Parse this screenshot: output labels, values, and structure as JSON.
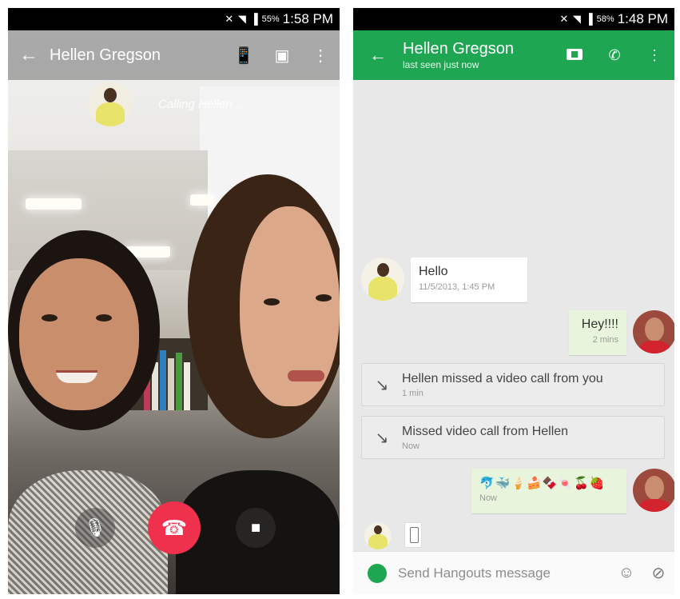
{
  "left_screen": {
    "status_time": "1:58 PM",
    "status_battery": "55%",
    "contact_name": "Hellen Gregson",
    "calling_text": "Calling Hellen...",
    "icons": {
      "back": "back-arrow-icon",
      "phone_signal": "cell-phone-icon",
      "contact_card": "contact-card-icon",
      "more": "more-vert-icon",
      "mic": "microphone-icon",
      "hangup": "hang-up-icon",
      "camera": "video-camera-icon"
    },
    "colors": {
      "hangup": "#f0314e"
    }
  },
  "right_screen": {
    "status_time": "1:48 PM",
    "status_battery": "58%",
    "contact_name": "Hellen Gregson",
    "last_seen": "last seen just now",
    "icons": {
      "back": "back-arrow-icon",
      "video_call": "video-call-icon",
      "phone": "phone-icon",
      "more": "more-vert-icon",
      "emoji": "smiley-icon",
      "attach": "paperclip-icon"
    },
    "messages": [
      {
        "text": "Hello",
        "time": "11/5/2013, 1:45 PM"
      },
      {
        "text": "Hey!!!!",
        "time": "2 mins"
      },
      {
        "text": "Hellen missed a video call from you",
        "time": "1 min"
      },
      {
        "text": "Missed video call from Hellen",
        "time": "Now"
      },
      {
        "text": "🐬🐳🍦🍰🍫🍬🍒🍓",
        "time": "Now"
      }
    ],
    "composer_placeholder": "Send Hangouts message",
    "colors": {
      "brand": "#1fa653",
      "outgoing_bubble": "#e8f5dc"
    }
  }
}
